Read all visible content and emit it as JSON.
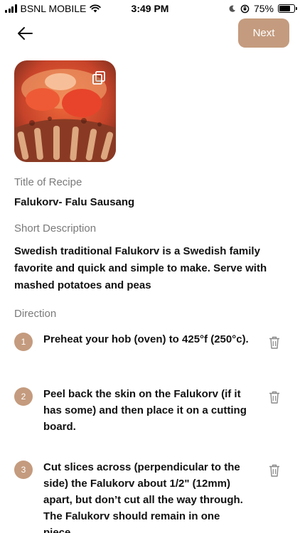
{
  "status_bar": {
    "carrier": "BSNL MOBILE",
    "time": "3:49 PM",
    "battery": "75%",
    "battery_level": 0.75
  },
  "header": {
    "back_icon": "arrow-left-icon",
    "next_label": "Next"
  },
  "recipe": {
    "image_alt": "",
    "copy_icon": "copy-icon",
    "title_label": "Title of Recipe",
    "title_value": "Falukorv- Falu Sausang",
    "description_label": "Short Description",
    "description_value": "Swedish traditional Falukorv is a Swedish family favorite and quick and simple to make. Serve with mashed potatoes and peas",
    "direction_label": "Direction"
  },
  "directions": [
    {
      "number": "1",
      "text": "Preheat your hob (oven) to 425°f (250°c).",
      "delete_icon": "trash-icon"
    },
    {
      "number": "2",
      "text": "Peel back the skin on the Falukorv (if it has some) and then place it on a cutting board.",
      "delete_icon": "trash-icon"
    },
    {
      "number": "3",
      "text": "Cut slices across (perpendicular to the side) the Falukorv about 1/2\" (12mm) apart, but don’t cut all the way through. The Falukorv should remain in one piece.",
      "delete_icon": "trash-icon"
    }
  ],
  "colors": {
    "accent": "#c49b7e",
    "label_gray": "#7a7a7a",
    "text": "#111111"
  }
}
